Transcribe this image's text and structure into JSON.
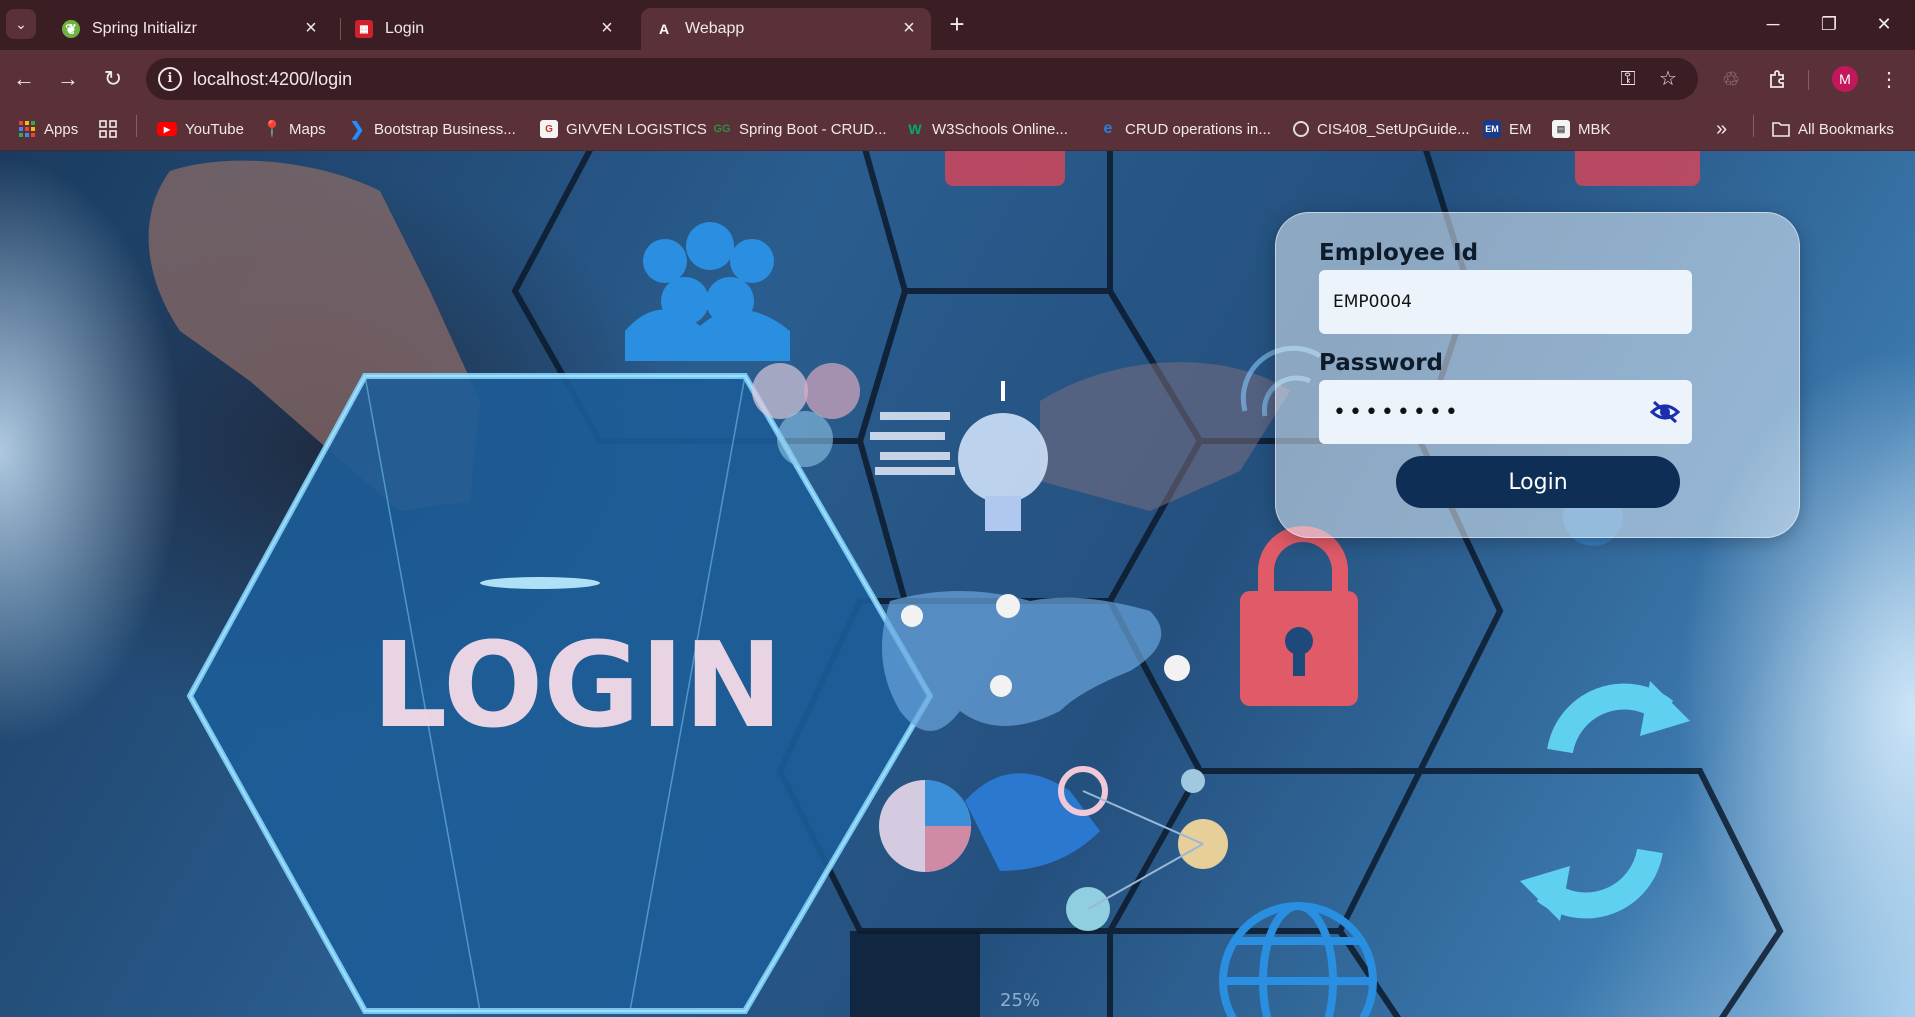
{
  "browser": {
    "tabs": [
      {
        "title": "Spring Initializr",
        "favicon": "spring-leaf-icon",
        "active": false
      },
      {
        "title": "Login",
        "favicon": "grid-logo-icon",
        "active": false
      },
      {
        "title": "Webapp",
        "favicon": "angular-icon",
        "active": true
      }
    ],
    "url": "localhost:4200/login",
    "profile_initial": "M",
    "colors": {
      "frame": "#3a1e23",
      "toolbar": "#5a3138",
      "accent": "#c2185b"
    }
  },
  "bookmarks": {
    "items": [
      {
        "label": "Apps",
        "icon": "apps-grid-icon"
      },
      {
        "label": "",
        "icon": "tab-groups-icon"
      },
      {
        "label": "YouTube",
        "icon": "youtube-icon"
      },
      {
        "label": "Maps",
        "icon": "maps-pin-icon"
      },
      {
        "label": "Bootstrap Business...",
        "icon": "bootstrap-icon"
      },
      {
        "label": "GIVVEN LOGISTICS",
        "icon": "givven-icon"
      },
      {
        "label": "Spring Boot - CRUD...",
        "icon": "gfg-icon"
      },
      {
        "label": "W3Schools Online...",
        "icon": "w3schools-icon"
      },
      {
        "label": "CRUD operations in...",
        "icon": "edge-icon"
      },
      {
        "label": "CIS408_SetUpGuide...",
        "icon": "globe-icon"
      },
      {
        "label": "EM",
        "icon": "em-icon"
      },
      {
        "label": "MBK",
        "icon": "mbk-icon"
      }
    ],
    "all_bookmarks": "All Bookmarks"
  },
  "login": {
    "employee_label": "Employee Id",
    "employee_value": "EMP0004",
    "password_label": "Password",
    "password_value": "••••••••",
    "button_label": "Login",
    "button_color": "#0f2e55"
  },
  "background": {
    "hero_text": "LOGIN",
    "small_text": "25%"
  }
}
